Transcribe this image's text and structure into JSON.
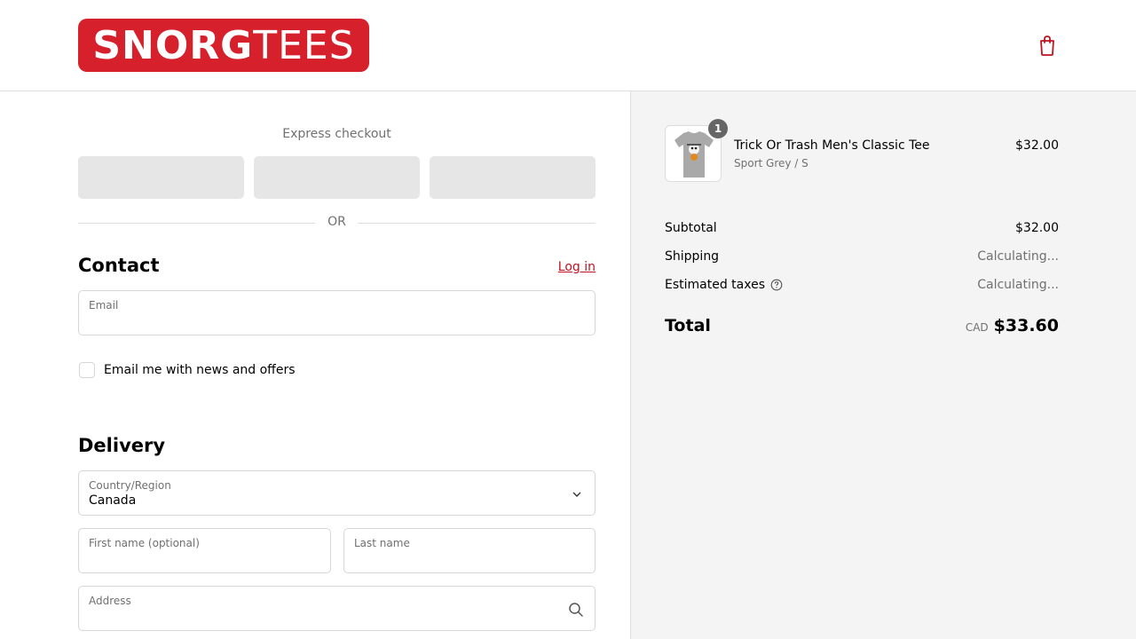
{
  "header": {
    "logo_bold": "SNORG",
    "logo_thin": "TEES",
    "cart_icon": "shopping-bag-icon",
    "brand_color": "#d6202b"
  },
  "express": {
    "title": "Express checkout",
    "or": "OR"
  },
  "contact": {
    "title": "Contact",
    "login": "Log in",
    "email_label": "Email",
    "email_value": "",
    "newsletter_label": "Email me with news and offers",
    "newsletter_checked": false
  },
  "delivery": {
    "title": "Delivery",
    "country_label": "Country/Region",
    "country_value": "Canada",
    "first_name_label": "First name (optional)",
    "last_name_label": "Last name",
    "address_label": "Address"
  },
  "summary": {
    "item": {
      "name": "Trick Or Trash Men's Classic Tee",
      "variant": "Sport Grey / S",
      "price": "$32.00",
      "quantity": "1"
    },
    "subtotal_label": "Subtotal",
    "subtotal_value": "$32.00",
    "shipping_label": "Shipping",
    "shipping_value": "Calculating...",
    "taxes_label": "Estimated taxes",
    "taxes_value": "Calculating...",
    "total_label": "Total",
    "total_currency": "CAD",
    "total_value": "$33.60"
  }
}
